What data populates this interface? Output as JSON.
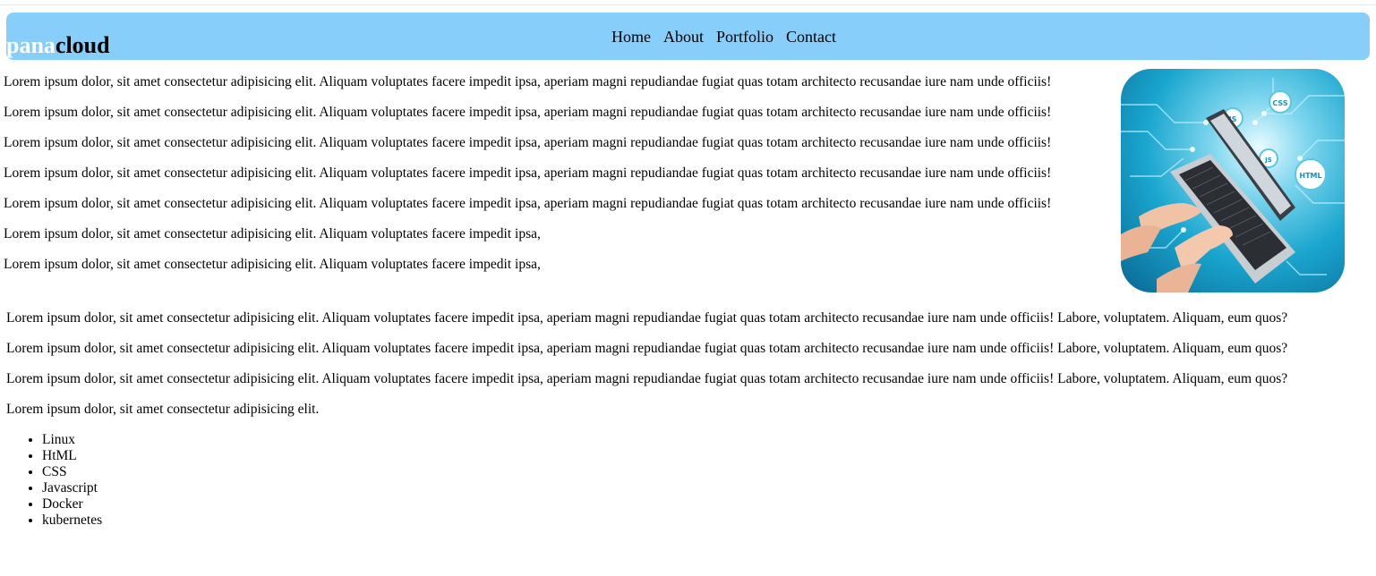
{
  "brand": {
    "part1": "pana",
    "part2": "cloud",
    "part1_color": "#ffffff",
    "part2_color": "#000000"
  },
  "header": {
    "background_color": "#87cefa"
  },
  "nav": {
    "items": [
      {
        "label": "Home"
      },
      {
        "label": "About"
      },
      {
        "label": "Portfolio"
      },
      {
        "label": "Contact"
      }
    ]
  },
  "intro_paragraphs": [
    "Lorem ipsum dolor, sit amet consectetur adipisicing elit. Aliquam voluptates facere impedit ipsa, aperiam magni repudiandae fugiat quas totam architecto recusandae iure nam unde officiis!",
    "Lorem ipsum dolor, sit amet consectetur adipisicing elit. Aliquam voluptates facere impedit ipsa, aperiam magni repudiandae fugiat quas totam architecto recusandae iure nam unde officiis!",
    "Lorem ipsum dolor, sit amet consectetur adipisicing elit. Aliquam voluptates facere impedit ipsa, aperiam magni repudiandae fugiat quas totam architecto recusandae iure nam unde officiis!",
    "Lorem ipsum dolor, sit amet consectetur adipisicing elit. Aliquam voluptates facere impedit ipsa, aperiam magni repudiandae fugiat quas totam architecto recusandae iure nam unde officiis!",
    "Lorem ipsum dolor, sit amet consectetur adipisicing elit. Aliquam voluptates facere impedit ipsa, aperiam magni repudiandae fugiat quas totam architecto recusandae iure nam unde officiis!",
    "Lorem ipsum dolor, sit amet consectetur adipisicing elit. Aliquam voluptates facere impedit ipsa,",
    "Lorem ipsum dolor, sit amet consectetur adipisicing elit. Aliquam voluptates facere impedit ipsa,"
  ],
  "hero_image": {
    "icon": "laptop-coding-icon",
    "badges": [
      "JS",
      "CSS",
      "JS",
      "HTML"
    ]
  },
  "body_paragraphs": [
    "Lorem ipsum dolor, sit amet consectetur adipisicing elit. Aliquam voluptates facere impedit ipsa, aperiam magni repudiandae fugiat quas totam architecto recusandae iure nam unde officiis! Labore, voluptatem. Aliquam, eum quos?",
    "Lorem ipsum dolor, sit amet consectetur adipisicing elit. Aliquam voluptates facere impedit ipsa, aperiam magni repudiandae fugiat quas totam architecto recusandae iure nam unde officiis! Labore, voluptatem. Aliquam, eum quos?",
    "Lorem ipsum dolor, sit amet consectetur adipisicing elit. Aliquam voluptates facere impedit ipsa, aperiam magni repudiandae fugiat quas totam architecto recusandae iure nam unde officiis! Labore, voluptatem. Aliquam, eum quos?",
    "Lorem ipsum dolor, sit amet consectetur adipisicing elit."
  ],
  "skills": [
    "Linux",
    "HtML",
    "CSS",
    "Javascript",
    "Docker",
    "kubernetes"
  ]
}
